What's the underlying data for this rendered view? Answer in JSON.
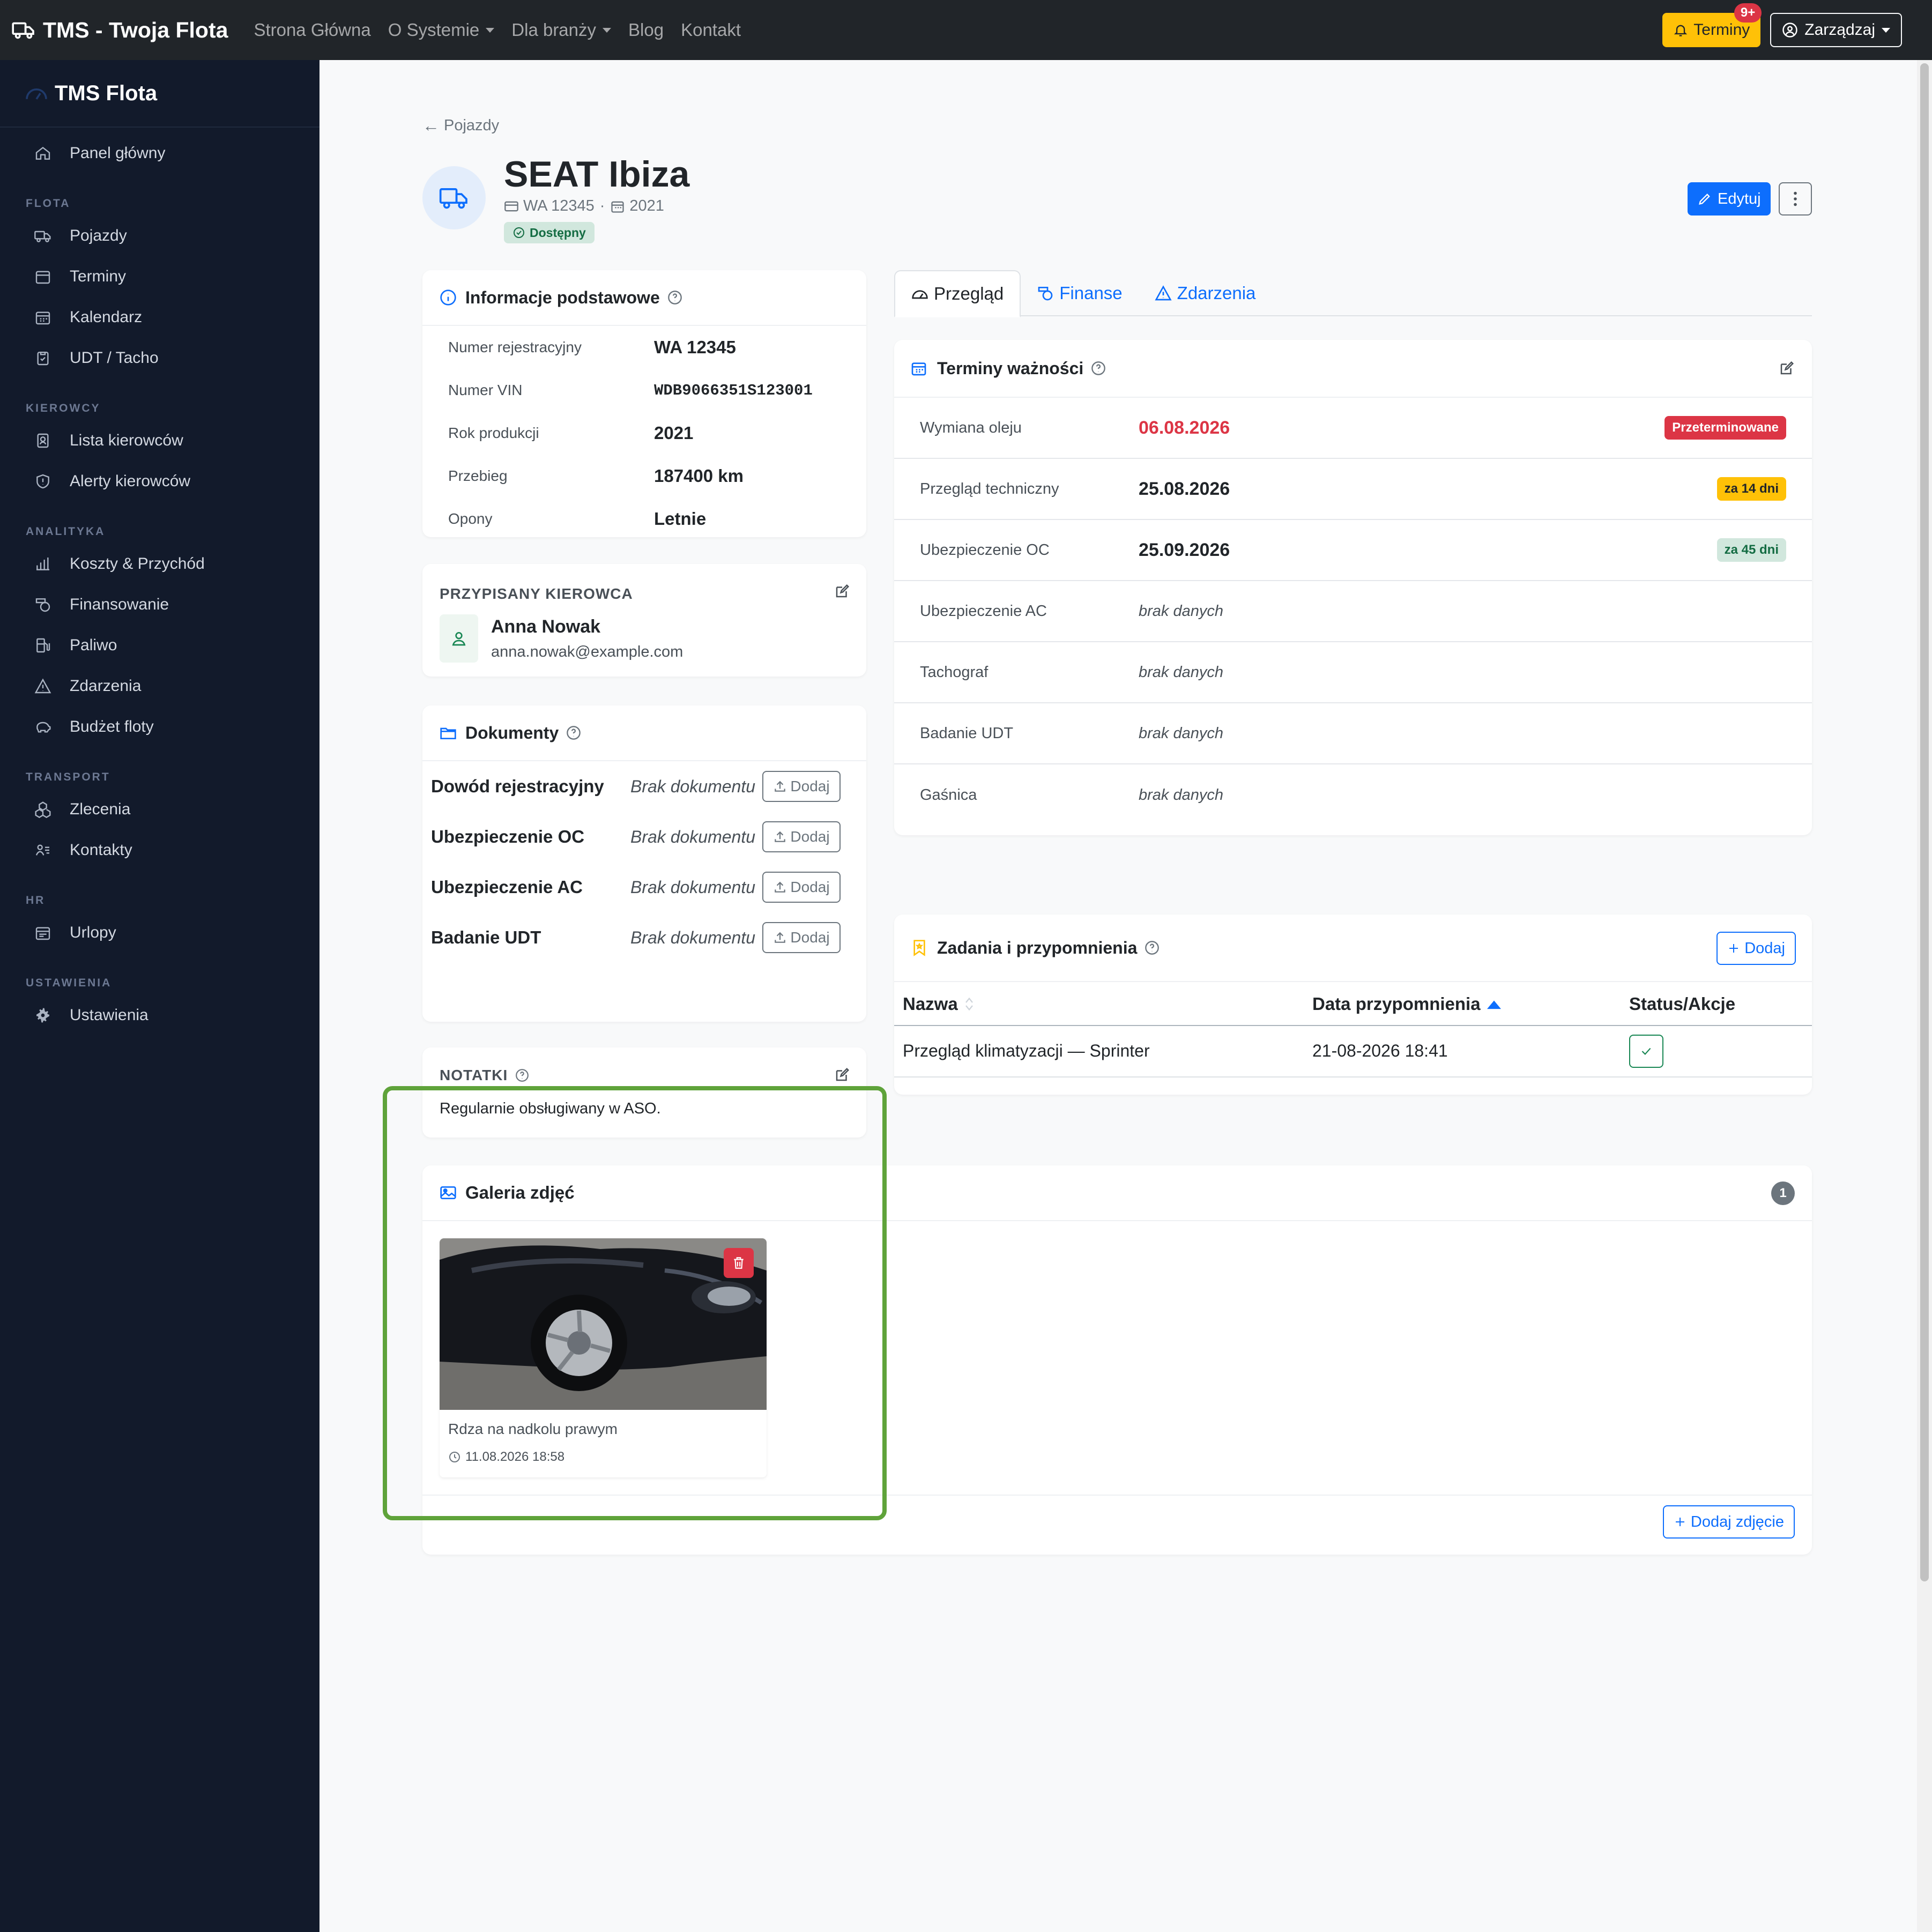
{
  "topnav": {
    "brand": "TMS - Twoja Flota",
    "links": [
      "Strona Główna",
      "O Systemie",
      "Dla branży",
      "Blog",
      "Kontakt"
    ],
    "terminy_label": "Terminy",
    "terminy_badge": "9+",
    "manage_label": "Zarządzaj"
  },
  "sidebar": {
    "brand": "TMS Flota",
    "panel": "Panel główny",
    "sections": {
      "flota": "FLOTA",
      "kierowcy": "KIEROWCY",
      "analityka": "ANALITYKA",
      "transport": "TRANSPORT",
      "hr": "HR",
      "ustawienia": "USTAWIENIA"
    },
    "items": {
      "pojazdy": "Pojazdy",
      "terminy": "Terminy",
      "kalendarz": "Kalendarz",
      "udt": "UDT / Tacho",
      "lista_kierowcow": "Lista kierowców",
      "alerty": "Alerty kierowców",
      "koszty": "Koszty & Przychód",
      "finansowanie": "Finansowanie",
      "paliwo": "Paliwo",
      "zdarzenia": "Zdarzenia",
      "budzet": "Budżet floty",
      "zlecenia": "Zlecenia",
      "kontakty": "Kontakty",
      "urlopy": "Urlopy",
      "ustawienia": "Ustawienia"
    }
  },
  "vehicle": {
    "back_label": "Pojazdy",
    "title": "SEAT Ibiza",
    "plate": "WA 12345",
    "sep": "·",
    "year": "2021",
    "status": "Dostępny",
    "edit_label": "Edytuj"
  },
  "info": {
    "title": "Informacje podstawowe",
    "rows": [
      {
        "label": "Numer rejestracyjny",
        "value": "WA 12345"
      },
      {
        "label": "Numer VIN",
        "value": "WDB9066351S123001"
      },
      {
        "label": "Rok produkcji",
        "value": "2021"
      },
      {
        "label": "Przebieg",
        "value": "187400 km"
      },
      {
        "label": "Opony",
        "value": "Letnie"
      }
    ]
  },
  "driver": {
    "caption": "PRZYPISANY KIEROWCA",
    "name": "Anna Nowak",
    "email": "anna.nowak@example.com"
  },
  "documents": {
    "title": "Dokumenty",
    "add_label": "Dodaj",
    "rows": [
      {
        "name": "Dowód rejestracyjny",
        "status": "Brak dokumentu"
      },
      {
        "name": "Ubezpieczenie OC",
        "status": "Brak dokumentu"
      },
      {
        "name": "Ubezpieczenie AC",
        "status": "Brak dokumentu"
      },
      {
        "name": "Badanie UDT",
        "status": "Brak dokumentu"
      }
    ]
  },
  "notes": {
    "caption": "NOTATKI",
    "text": "Regularnie obsługiwany w ASO."
  },
  "tabs": [
    "Przegląd",
    "Finanse",
    "Zdarzenia"
  ],
  "deadlines": {
    "title": "Terminy ważności",
    "rows": [
      {
        "label": "Wymiana oleju",
        "value": "06.08.2026",
        "badge": "Przeterminowane"
      },
      {
        "label": "Przegląd techniczny",
        "value": "25.08.2026",
        "badge": "za 14 dni"
      },
      {
        "label": "Ubezpieczenie OC",
        "value": "25.09.2026",
        "badge": "za 45 dni"
      },
      {
        "label": "Ubezpieczenie AC",
        "value": "brak danych"
      },
      {
        "label": "Tachograf",
        "value": "brak danych"
      },
      {
        "label": "Badanie UDT",
        "value": "brak danych"
      },
      {
        "label": "Gaśnica",
        "value": "brak danych"
      }
    ]
  },
  "tasks": {
    "title": "Zadania i przypomnienia",
    "add_label": "Dodaj",
    "columns": [
      "Nazwa",
      "Data przypomnienia",
      "Status/Akcje"
    ],
    "rows": [
      {
        "name": "Przegląd klimatyzacji — Sprinter",
        "date": "21-08-2026 18:41"
      }
    ]
  },
  "gallery": {
    "title": "Galeria zdjęć",
    "count": "1",
    "photo_caption": "Rdza na nadkolu prawym",
    "photo_date": "11.08.2026 18:58",
    "add_photo_label": "Dodaj zdjęcie"
  },
  "colors": {
    "navbar": "#212529",
    "sidebar": "#121a2b",
    "primary": "#0d6efd",
    "danger": "#dc3545",
    "warning": "#ffc107",
    "success": "#198754",
    "highlight": "#5fa33a"
  }
}
